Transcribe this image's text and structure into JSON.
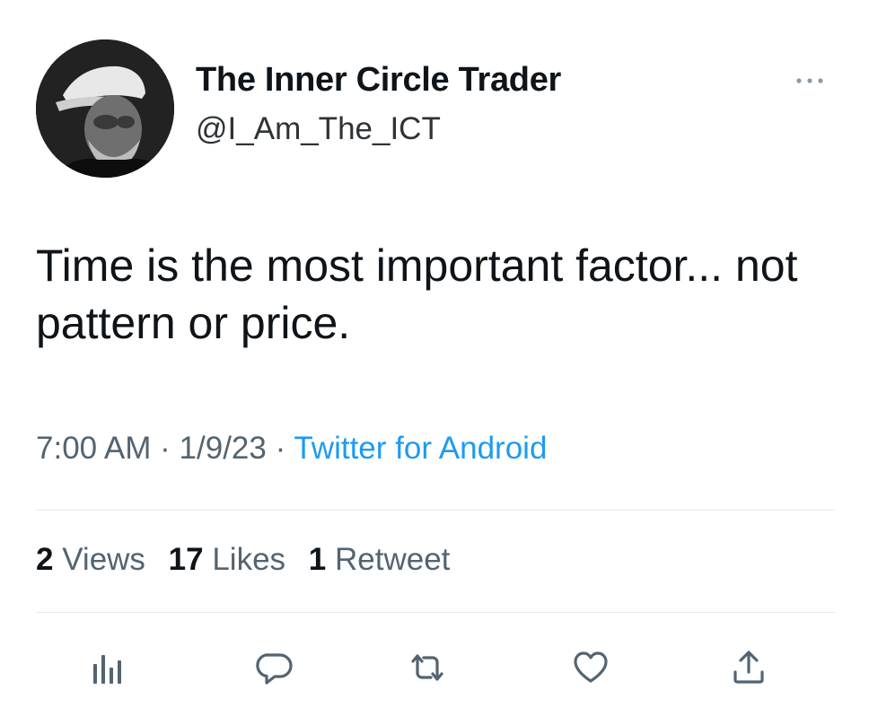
{
  "author": {
    "display_name": "The Inner Circle Trader",
    "handle": "@I_Am_The_ICT"
  },
  "tweet": {
    "text": "Time is the most important factor... not pattern or price.",
    "time": "7:00 AM",
    "date": "1/9/23",
    "separator": "·",
    "source": "Twitter for Android"
  },
  "stats": {
    "views_count": "2",
    "views_label": "Views",
    "likes_count": "17",
    "likes_label": "Likes",
    "retweets_count": "1",
    "retweets_label": "Retweet"
  },
  "actions": [
    "analytics-icon",
    "reply-icon",
    "retweet-icon",
    "like-icon",
    "share-icon"
  ],
  "colors": {
    "link": "#1d9bf0",
    "secondary_text": "#536471",
    "primary_text": "#0f1419",
    "icon": "#536471",
    "divider": "#e6e9eb"
  }
}
